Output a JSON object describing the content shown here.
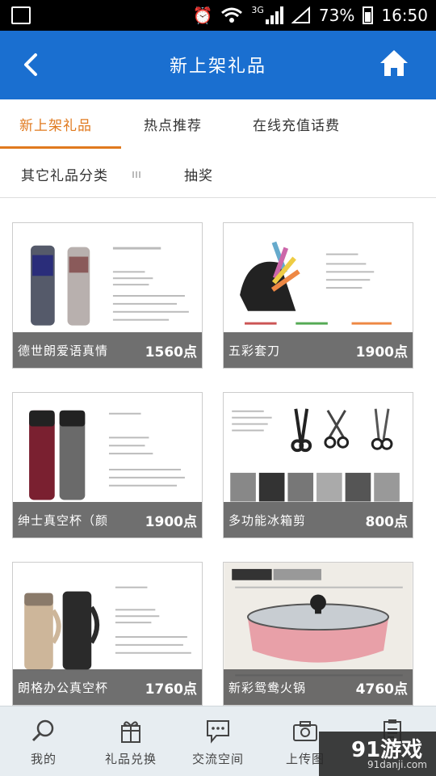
{
  "status_bar": {
    "network": "3G",
    "battery": "73%",
    "time": "16:50"
  },
  "header": {
    "title": "新上架礼品",
    "back_icon": "chevron-left-icon",
    "home_icon": "home-icon"
  },
  "tabs": [
    {
      "label": "新上架礼品",
      "active": true
    },
    {
      "label": "热点推荐",
      "active": false
    },
    {
      "label": "在线充值话费",
      "active": false
    },
    {
      "label": "其它礼品分类",
      "active": false
    },
    {
      "label": "抽奖",
      "active": false
    }
  ],
  "products": [
    {
      "name": "德世朗爱语真情",
      "price": "1560点"
    },
    {
      "name": "五彩套刀",
      "price": "1900点"
    },
    {
      "name": "绅士真空杯（颜",
      "price": "1900点"
    },
    {
      "name": "多功能冰箱剪",
      "price": "800点"
    },
    {
      "name": "朗格办公真空杯",
      "price": "1760点"
    },
    {
      "name": "新彩鸳鸯火锅",
      "price": "4760点"
    }
  ],
  "bottom_nav": [
    {
      "label": "我的",
      "icon": "search-icon"
    },
    {
      "label": "礼品兑换",
      "icon": "gift-icon"
    },
    {
      "label": "交流空间",
      "icon": "chat-icon"
    },
    {
      "label": "上传图",
      "icon": "camera-icon"
    },
    {
      "label": "",
      "icon": "clipboard-icon"
    }
  ],
  "watermark": {
    "logo": "91游戏",
    "url": "91danji.com"
  },
  "colors": {
    "header": "#1a6fd0",
    "accent": "#e07a1f"
  }
}
